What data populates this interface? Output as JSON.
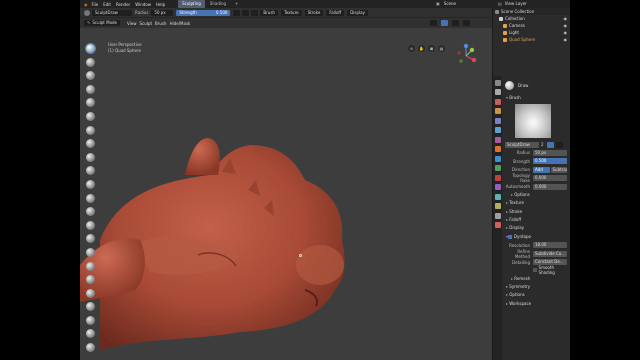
{
  "menubar": {
    "items": [
      "File",
      "Edit",
      "Render",
      "Window",
      "Help"
    ],
    "workspace_tabs": [
      "Sculpting",
      "Shading"
    ],
    "active_tab": "Sculpting",
    "add_tab": "+",
    "scene_label": "Scene",
    "view_layer_label": "View Layer"
  },
  "tool_header": {
    "brush_name": "SculptDraw",
    "radius_label": "Radius",
    "radius_value": "50 px",
    "strength_label": "Strength",
    "strength_value": "0.500",
    "menus": [
      "Brush",
      "Texture",
      "Stroke",
      "Falloff",
      "Display"
    ]
  },
  "mode_header": {
    "mode": "Sculpt Mode",
    "menus": [
      "View",
      "Sculpt",
      "Brush",
      "Hide/Mask"
    ]
  },
  "viewport": {
    "line1": "User Perspective",
    "line2": "(1) Quad Sphere",
    "tool_count": 23,
    "active_tool_index": 0,
    "gizmo": {
      "x_color": "#e0465a",
      "y_color": "#8fcf3a",
      "z_color": "#4e8fe0"
    },
    "sculpt_color": "#a84a36"
  },
  "outliner": {
    "title": "Scene Collection",
    "items": [
      {
        "label": "Collection",
        "icon": "collection-icon",
        "color": "#d0d0d0"
      },
      {
        "label": "Camera",
        "icon": "camera-icon",
        "color": "#e8a04a"
      },
      {
        "label": "Light",
        "icon": "light-icon",
        "color": "#e8a04a"
      },
      {
        "label": "Quad Sphere",
        "icon": "mesh-icon",
        "color": "#e8a04a",
        "highlight": true
      }
    ]
  },
  "properties": {
    "tool_label": "Draw",
    "brush_section": "Brush",
    "brush_name": "SculptDraw",
    "brush_users": "2",
    "fields": [
      {
        "key": "Radius",
        "value": "50 px"
      },
      {
        "key": "Strength",
        "value": "0.500",
        "blue": true
      },
      {
        "key": "Direction",
        "value": "Add",
        "alt": "Subtract"
      },
      {
        "key": "Topology Rake",
        "value": "0.000"
      },
      {
        "key": "Autosmooth",
        "value": "0.000"
      }
    ],
    "sections": [
      "Options",
      "Texture",
      "Stroke",
      "Falloff",
      "Display"
    ],
    "dyntopo_label": "Dyntopo",
    "dyntopo_fields": [
      {
        "key": "Resolution",
        "value": "18.00"
      },
      {
        "key": "Refine Method",
        "value": "Subdivide Co..."
      },
      {
        "key": "Detailing",
        "value": "Constant De..."
      }
    ],
    "smooth_shading": "Smooth Shading",
    "remesh": "Remesh",
    "bottom_sections": [
      "Symmetry",
      "Options",
      "Workspace"
    ]
  }
}
